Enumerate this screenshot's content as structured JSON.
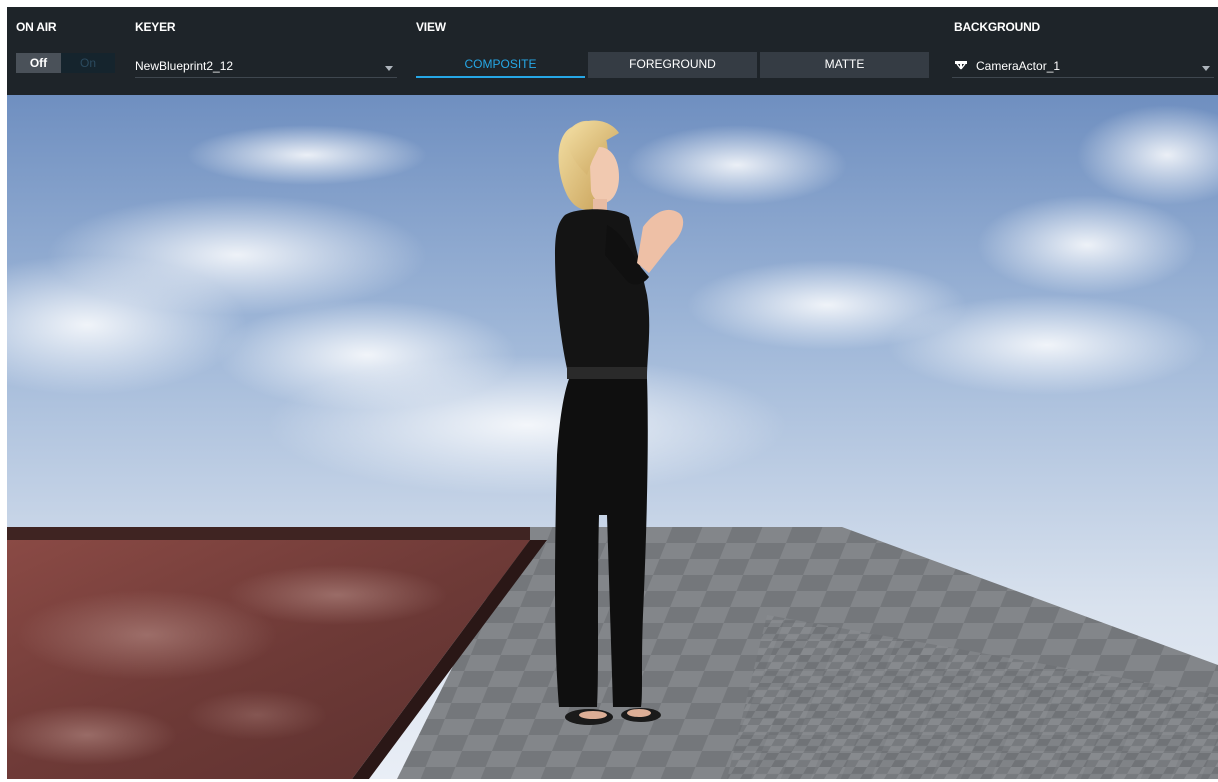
{
  "toolbar": {
    "on_air": {
      "label": "ON AIR",
      "off_label": "Off",
      "on_label": "On",
      "state": "off"
    },
    "keyer": {
      "label": "KEYER",
      "selected": "NewBlueprint2_12"
    },
    "view": {
      "label": "VIEW",
      "tabs": [
        {
          "label": "COMPOSITE",
          "active": true
        },
        {
          "label": "FOREGROUND",
          "active": false
        },
        {
          "label": "MATTE",
          "active": false
        }
      ]
    },
    "background": {
      "label": "BACKGROUND",
      "selected": "CameraActor_1",
      "icon": "camera-icon"
    }
  },
  "colors": {
    "toolbar_bg": "#1e2429",
    "accent": "#26a7e6",
    "tab_bg": "#353c44",
    "toggle_off_bg": "#4a5159"
  }
}
